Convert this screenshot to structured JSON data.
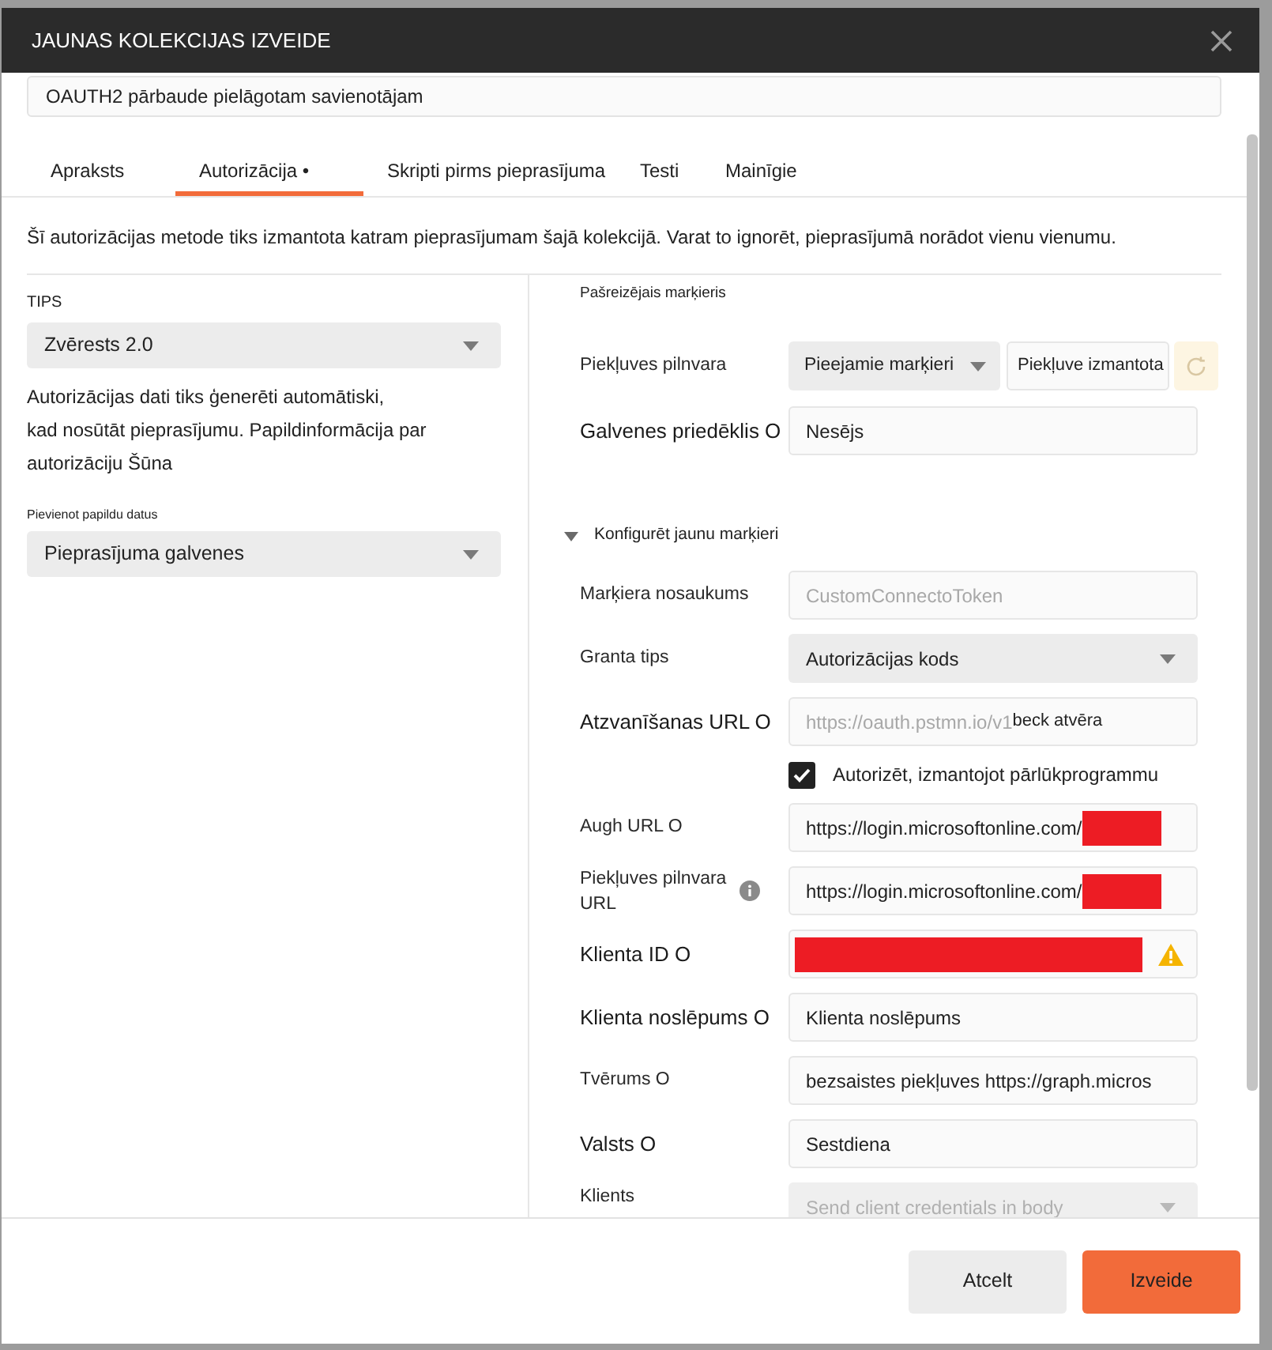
{
  "dialog": {
    "title": "JAUNAS KOLEKCIJAS IZVEIDE"
  },
  "collection_name": {
    "value": "OAUTH2 pārbaude pielāgotam savienotājam"
  },
  "tabs": [
    {
      "label": "Apraksts",
      "selected": false
    },
    {
      "label": "Autorizācija •",
      "selected": true
    },
    {
      "label": "Skripti pirms pieprasījuma",
      "selected": false
    },
    {
      "label": "Testi",
      "selected": false
    },
    {
      "label": "Mainīgie",
      "selected": false
    }
  ],
  "description": "Šī autorizācijas metode tiks izmantota katram pieprasījumam šajā kolekcijā. Varat to ignorēt, pieprasījumā norādot vienu vienumu.",
  "auth_type": {
    "label": "TIPS",
    "value": "Zvērests 2.0"
  },
  "auth_info": "Autorizācijas dati tiks ģenerēti automātiski,\nkad nosūtāt pieprasījumu. Papildinformācija par\nautorizāciju Šūna",
  "add_to": {
    "label": "Pievienot papildu datus",
    "value": "Pieprasījuma galvenes"
  },
  "current_token": {
    "title": "Pašreizējais marķieris",
    "fields": [
      {
        "kind": "token_picker",
        "label": "Piekļuves pilnvara",
        "select": "Pieejamie marķieri",
        "value": "Piekļuve izmantota"
      },
      {
        "kind": "input",
        "label": "Galvenes priedēklis O",
        "value": "Nesējs"
      }
    ]
  },
  "new_token": {
    "title": "Konfigurēt jaunu marķieri",
    "expanded": true,
    "fields": [
      {
        "kind": "input",
        "label": "Marķiera nosaukums",
        "placeholder": "CustomConnectoToken"
      },
      {
        "kind": "select",
        "label": "Granta tips",
        "value": "Autorizācijas kods"
      },
      {
        "kind": "input",
        "label": "Atzvanīšanas URL O",
        "placeholder": "https://oauth.pstmn.io/v1",
        "value": "beck atvēra"
      },
      {
        "kind": "checkbox",
        "label": "Autorizēt, izmantojot pārlūkprogrammu",
        "checked": true
      },
      {
        "kind": "input",
        "label": "Augh URL O",
        "value": "https://login.microsoftonline.com/",
        "redacted": true
      },
      {
        "kind": "input",
        "label": "Piekļuves pilnvara URL",
        "value": "https://login.microsoftonline.com/",
        "redacted": true,
        "help": true
      },
      {
        "kind": "input",
        "label": "Klienta ID O",
        "redacted": true,
        "warning": true
      },
      {
        "kind": "input",
        "label": "Klienta noslēpums O",
        "value": "Klienta noslēpums"
      },
      {
        "kind": "input",
        "label": "Tvērums O",
        "value": "bezsaistes piekļuves https://graph.micros"
      },
      {
        "kind": "input",
        "label": "Valsts O",
        "value": "Sestdiena"
      },
      {
        "kind": "select",
        "label": "Klients",
        "value": "Send client credentials in body",
        "disabled": true
      }
    ]
  },
  "buttons": [
    {
      "label": "Atcelt",
      "kind": "secondary"
    },
    {
      "label": "Izveide",
      "kind": "primary"
    }
  ]
}
